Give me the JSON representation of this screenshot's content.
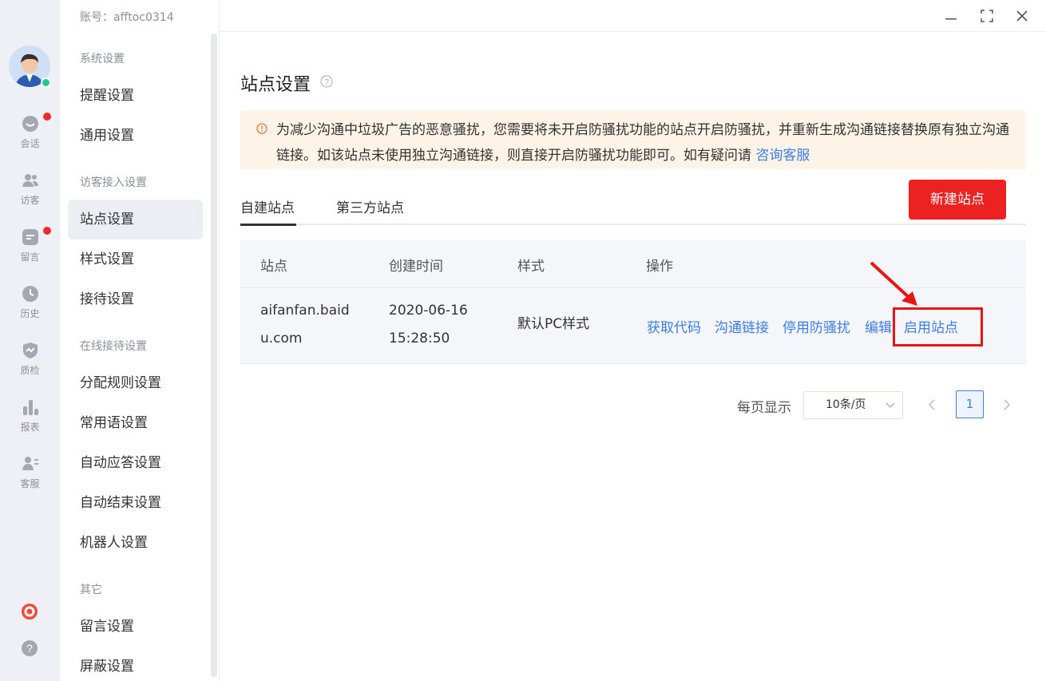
{
  "account": {
    "label": "账号：afftoc0314"
  },
  "rail": {
    "items": [
      {
        "icon": "chat-icon",
        "label": "会话",
        "badge": true
      },
      {
        "icon": "visitors-icon",
        "label": "访客",
        "badge": false
      },
      {
        "icon": "message-icon",
        "label": "留言",
        "badge": true
      },
      {
        "icon": "history-icon",
        "label": "历史",
        "badge": false
      },
      {
        "icon": "quality-check-icon",
        "label": "质检",
        "badge": false
      },
      {
        "icon": "report-icon",
        "label": "报表",
        "badge": false
      },
      {
        "icon": "agent-icon",
        "label": "客服",
        "badge": false
      }
    ],
    "bottom_icons": [
      "lifebuoy-icon",
      "help-icon"
    ]
  },
  "sidebar": {
    "groups": [
      {
        "title": "系统设置",
        "items": [
          "提醒设置",
          "通用设置"
        ]
      },
      {
        "title": "访客接入设置",
        "items": [
          "站点设置",
          "样式设置",
          "接待设置"
        ]
      },
      {
        "title": "在线接待设置",
        "items": [
          "分配规则设置",
          "常用语设置",
          "自动应答设置",
          "自动结束设置",
          "机器人设置"
        ]
      },
      {
        "title": "其它",
        "items": [
          "留言设置",
          "屏蔽设置"
        ]
      }
    ],
    "active_item": "站点设置"
  },
  "main": {
    "title": "站点设置",
    "notice": {
      "text": "为减少沟通中垃圾广告的恶意骚扰，您需要将未开启防骚扰功能的站点开启防骚扰，并重新生成沟通链接替换原有独立沟通链接。如该站点未使用独立沟通链接，则直接开启防骚扰功能即可。如有疑问请 ",
      "link": "咨询客服"
    },
    "tabs": [
      "自建站点",
      "第三方站点"
    ],
    "active_tab": "自建站点",
    "new_button": "新建站点",
    "table": {
      "headers": [
        "站点",
        "创建时间",
        "样式",
        "操作"
      ],
      "rows": [
        {
          "site_line1": "aifanfan.baid",
          "site_line2": "u.com",
          "date": "2020-06-16",
          "time": "15:28:50",
          "style": "默认PC样式",
          "actions": [
            "获取代码",
            "沟通链接",
            "停用防骚扰",
            "编辑",
            "启用站点"
          ]
        }
      ]
    },
    "pagination": {
      "label": "每页显示",
      "page_size": "10条/页",
      "current_page": "1"
    }
  },
  "colors": {
    "accent": "#3b7ded",
    "danger": "#ec2222",
    "notice_bg": "#fdf3e6",
    "online": "#22c98f"
  }
}
